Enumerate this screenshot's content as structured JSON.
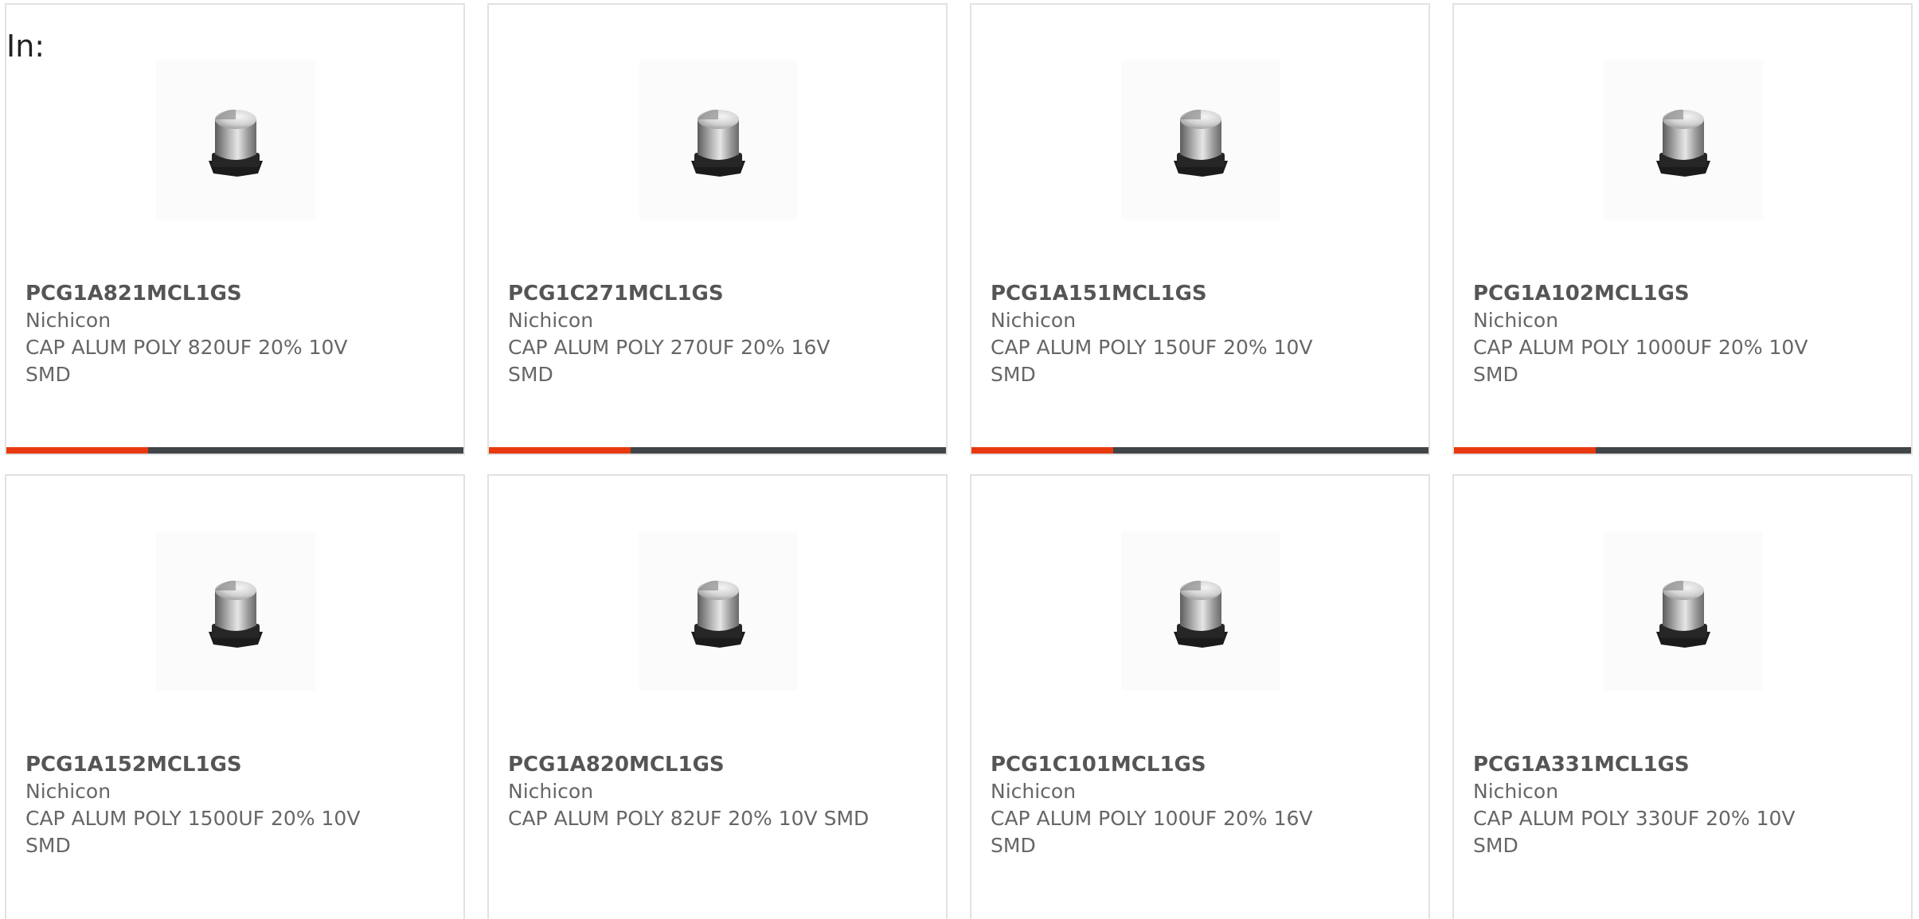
{
  "header": {
    "in_label": "In:"
  },
  "theme": {
    "accent": "#e8390e",
    "bar_track": "#424547",
    "card_border": "#e2e2e2",
    "text": "#666666"
  },
  "cards": [
    {
      "part_number": "PCG1A821MCL1GS",
      "manufacturer": "Nichicon",
      "description": "CAP ALUM POLY 820UF 20% 10V SMD",
      "image_icon": "capacitor-icon",
      "progress": 0.31
    },
    {
      "part_number": "PCG1C271MCL1GS",
      "manufacturer": "Nichicon",
      "description": "CAP ALUM POLY 270UF 20% 16V SMD",
      "image_icon": "capacitor-icon",
      "progress": 0.31
    },
    {
      "part_number": "PCG1A151MCL1GS",
      "manufacturer": "Nichicon",
      "description": "CAP ALUM POLY 150UF 20% 10V SMD",
      "image_icon": "capacitor-icon",
      "progress": 0.31
    },
    {
      "part_number": "PCG1A102MCL1GS",
      "manufacturer": "Nichicon",
      "description": "CAP ALUM POLY 1000UF 20% 10V SMD",
      "image_icon": "capacitor-icon",
      "progress": 0.31
    },
    {
      "part_number": "PCG1A152MCL1GS",
      "manufacturer": "Nichicon",
      "description": "CAP ALUM POLY 1500UF 20% 10V SMD",
      "image_icon": "capacitor-icon"
    },
    {
      "part_number": "PCG1A820MCL1GS",
      "manufacturer": "Nichicon",
      "description": "CAP ALUM POLY 82UF 20% 10V SMD",
      "image_icon": "capacitor-icon"
    },
    {
      "part_number": "PCG1C101MCL1GS",
      "manufacturer": "Nichicon",
      "description": "CAP ALUM POLY 100UF 20% 16V SMD",
      "image_icon": "capacitor-icon"
    },
    {
      "part_number": "PCG1A331MCL1GS",
      "manufacturer": "Nichicon",
      "description": "CAP ALUM POLY 330UF 20% 10V SMD",
      "image_icon": "capacitor-icon"
    }
  ]
}
